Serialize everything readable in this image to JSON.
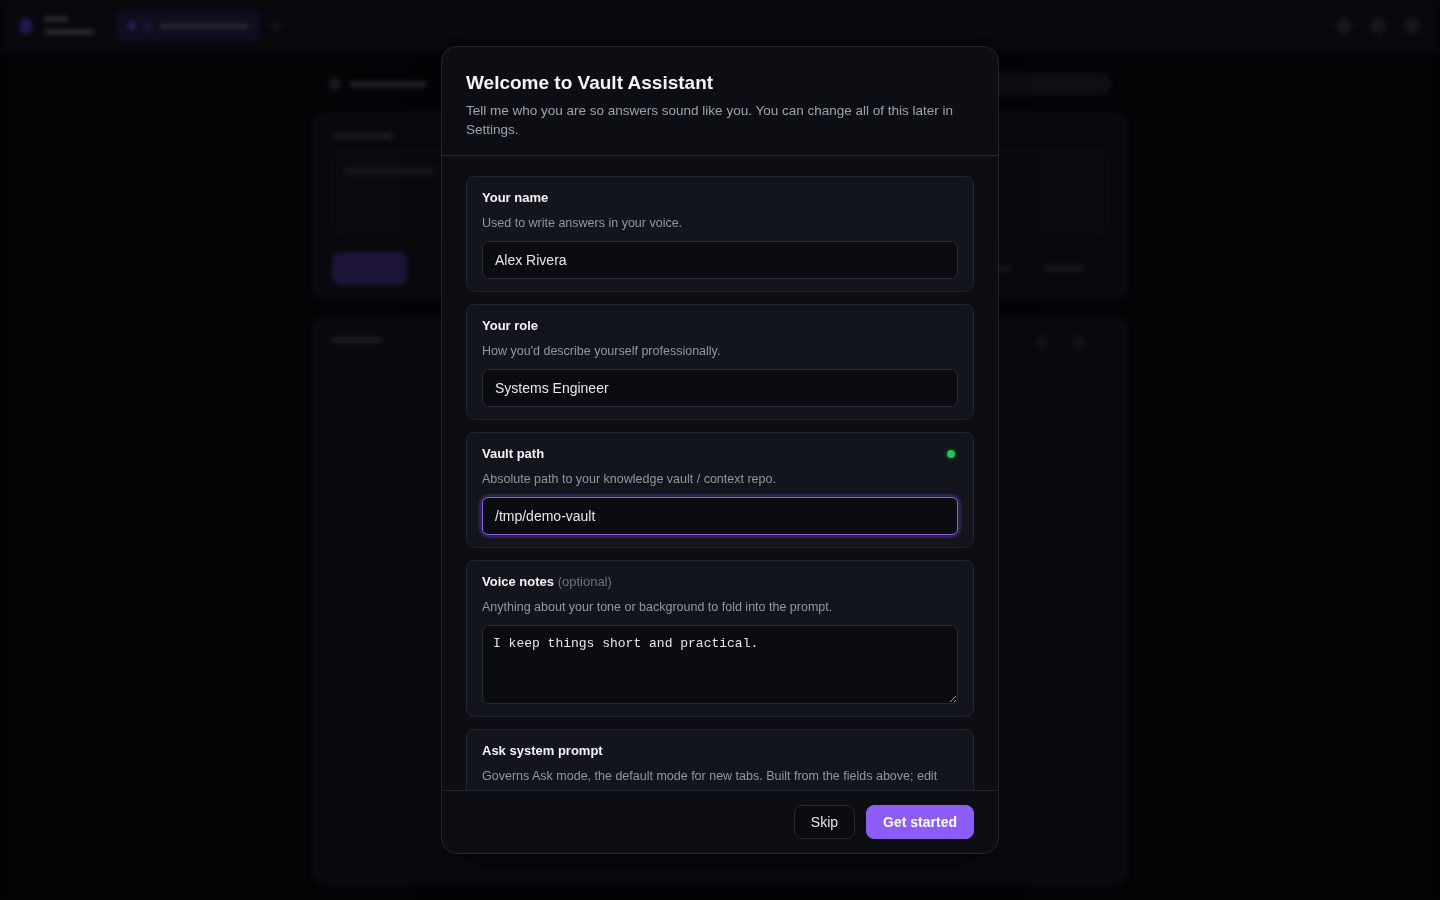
{
  "dialog": {
    "title": "Welcome to Vault Assistant",
    "subtitle": "Tell me who you are so answers sound like you. You can change all of this later in Settings."
  },
  "fields": [
    {
      "kind": "input",
      "label": "Your name",
      "description": "Used to write answers in your voice.",
      "value": "Alex Rivera",
      "focused": false,
      "status_dot": false
    },
    {
      "kind": "input",
      "label": "Your role",
      "description": "How you'd describe yourself professionally.",
      "value": "Systems Engineer",
      "focused": false,
      "status_dot": false
    },
    {
      "kind": "input",
      "label": "Vault path",
      "description": "Absolute path to your knowledge vault / context repo.",
      "value": "/tmp/demo-vault",
      "focused": true,
      "status_dot": true
    },
    {
      "kind": "textarea",
      "label": "Voice notes",
      "label_note": "(optional)",
      "description": "Anything about your tone or background to fold into the prompt.",
      "value": "I keep things short and practical.",
      "focused": false,
      "status_dot": false
    },
    {
      "kind": "prompt",
      "label": "Ask system prompt",
      "description": "Governs Ask mode, the default mode for new tabs. Built from the fields above; edit",
      "status_dot": false
    }
  ],
  "buttons": [
    {
      "kind": "secondary",
      "label": "Skip"
    },
    {
      "kind": "primary",
      "label": "Get started"
    }
  ]
}
